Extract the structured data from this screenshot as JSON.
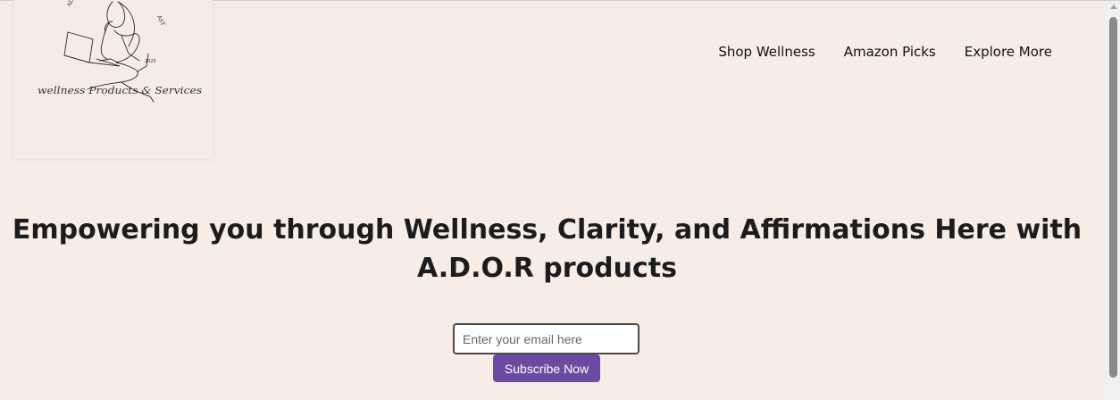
{
  "logo": {
    "alt": "A.D.O.R wellness logo",
    "arc_text": "ADORE PODCAST",
    "year": "2025",
    "tagline": "wellness Products & Services"
  },
  "nav": {
    "items": [
      {
        "label": "Shop Wellness"
      },
      {
        "label": "Amazon Picks"
      },
      {
        "label": "Explore More"
      }
    ]
  },
  "hero": {
    "title": "Empowering you through Wellness, Clarity, and Affirmations Here with A.D.O.R products"
  },
  "subscribe": {
    "email_placeholder": "Enter your email here",
    "email_value": "",
    "button_label": "Subscribe Now"
  },
  "colors": {
    "background": "#f7ede7",
    "button": "#6b4aa1",
    "text": "#1c1c1c"
  }
}
